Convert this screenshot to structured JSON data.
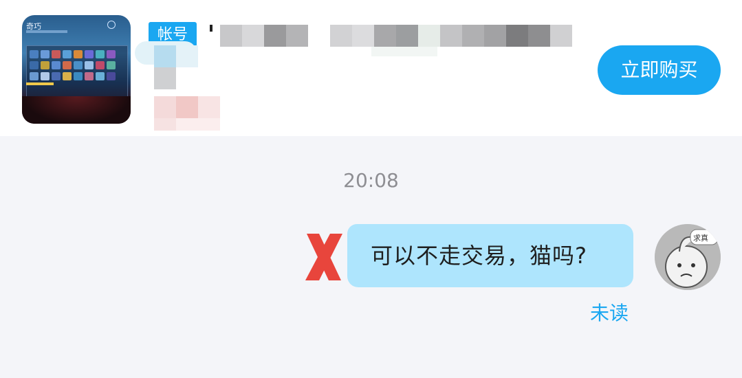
{
  "product": {
    "thumbnail_title": "奇巧",
    "tag_label": "帐号",
    "buy_button_label": "立即购买"
  },
  "chat": {
    "timestamp": "20:08",
    "message_text": "可以不走交易，猫吗?",
    "read_status": "未读",
    "avatar_badge": "求真"
  },
  "colors": {
    "accent": "#1aa7f1",
    "bubble": "#aee5fd",
    "background": "#f4f5f9",
    "cross_mark": "#e8453c"
  }
}
